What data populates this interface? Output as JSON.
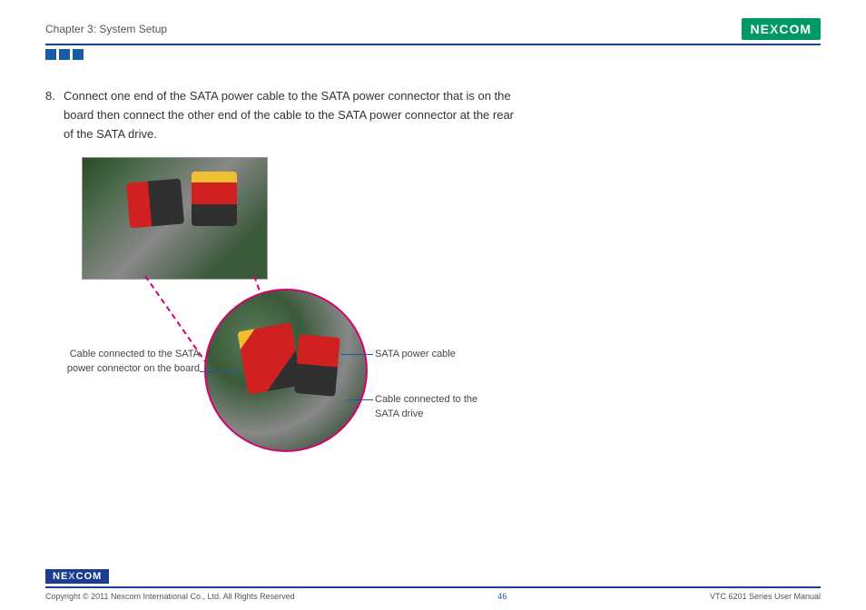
{
  "header": {
    "chapter": "Chapter 3: System Setup",
    "brand": "NEXCOM"
  },
  "step": {
    "number": "8.",
    "text": "Connect one end of the SATA power cable to the SATA power connector that is on the board then connect the other end of the cable to the SATA power connector at the rear of the SATA drive."
  },
  "callouts": {
    "left": "Cable connected to the SATA power connector on the board",
    "right1": "SATA power cable",
    "right2": "Cable connected to the SATA drive"
  },
  "footer": {
    "brand": "NEXCOM",
    "copyright": "Copyright © 2011 Nexcom International Co., Ltd. All Rights Reserved",
    "page": "46",
    "doc": "VTC 6201 Series User Manual"
  }
}
